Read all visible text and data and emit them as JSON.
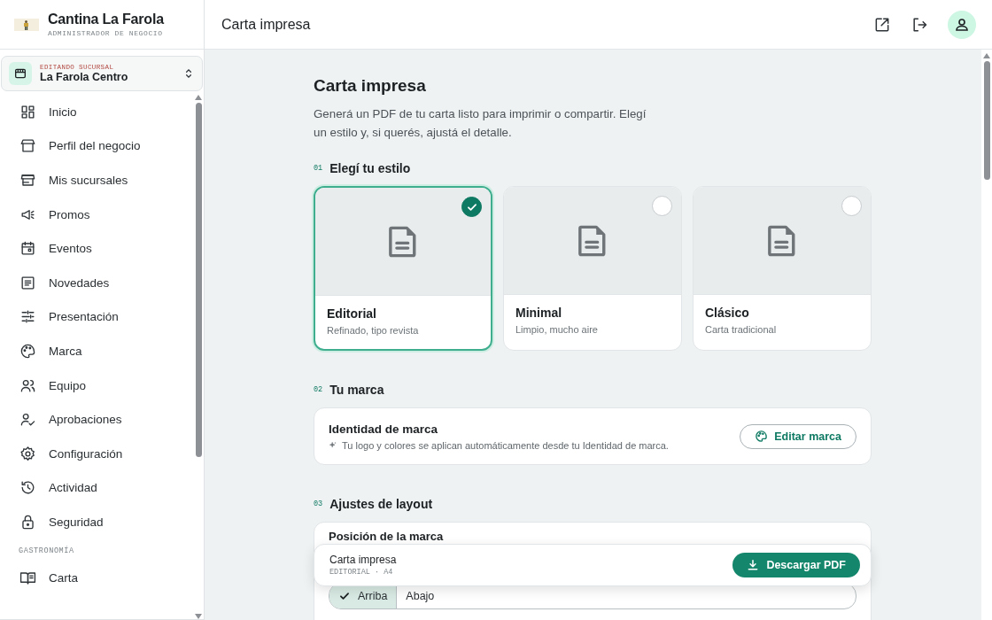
{
  "brand": {
    "name": "Cantina La Farola",
    "subtitle": "ADMINISTRADOR DE NEGOCIO"
  },
  "branch_switcher": {
    "label": "EDITANDO SUCURSAL",
    "value": "La Farola Centro"
  },
  "sidebar": {
    "items": [
      {
        "label": "Inicio",
        "selected": false
      },
      {
        "label": "Perfil del negocio",
        "selected": false
      },
      {
        "label": "Mis sucursales",
        "selected": false
      },
      {
        "label": "Promos",
        "selected": false
      },
      {
        "label": "Eventos",
        "selected": false
      },
      {
        "label": "Novedades",
        "selected": false
      },
      {
        "label": "Presentación",
        "selected": false
      },
      {
        "label": "Marca",
        "selected": false
      },
      {
        "label": "Equipo",
        "selected": false
      },
      {
        "label": "Aprobaciones",
        "selected": false
      },
      {
        "label": "Configuración",
        "selected": false
      },
      {
        "label": "Actividad",
        "selected": false
      },
      {
        "label": "Seguridad",
        "selected": false
      }
    ],
    "section": "GASTRONOMÍA",
    "section_items": [
      {
        "label": "Carta",
        "selected": false
      }
    ]
  },
  "header": {
    "title": "Carta impresa"
  },
  "page": {
    "title": "Carta impresa",
    "description": "Generá un PDF de tu carta listo para imprimir o compartir. Elegí un estilo y, si querés, ajustá el detalle."
  },
  "sections": [
    {
      "number": "01",
      "title": "Elegí tu estilo"
    },
    {
      "number": "02",
      "title": "Tu marca"
    },
    {
      "number": "03",
      "title": "Ajustes de layout"
    }
  ],
  "styles": [
    {
      "name": "Editorial",
      "description": "Refinado, tipo revista",
      "selected": true
    },
    {
      "name": "Minimal",
      "description": "Limpio, mucho aire",
      "selected": false
    },
    {
      "name": "Clásico",
      "description": "Carta tradicional",
      "selected": false
    }
  ],
  "brand_identity": {
    "title": "Identidad de marca",
    "note": "Tu logo y colores se aplican automáticamente desde tu Identidad de marca.",
    "button": "Editar marca"
  },
  "layout": {
    "label": "Posición de la marca",
    "options": [
      {
        "label": "Arriba",
        "selected": true
      },
      {
        "label": "Abajo",
        "selected": false
      }
    ]
  },
  "download_bar": {
    "title": "Carta impresa",
    "meta": "EDITORIAL · A4",
    "button": "Descargar PDF"
  }
}
